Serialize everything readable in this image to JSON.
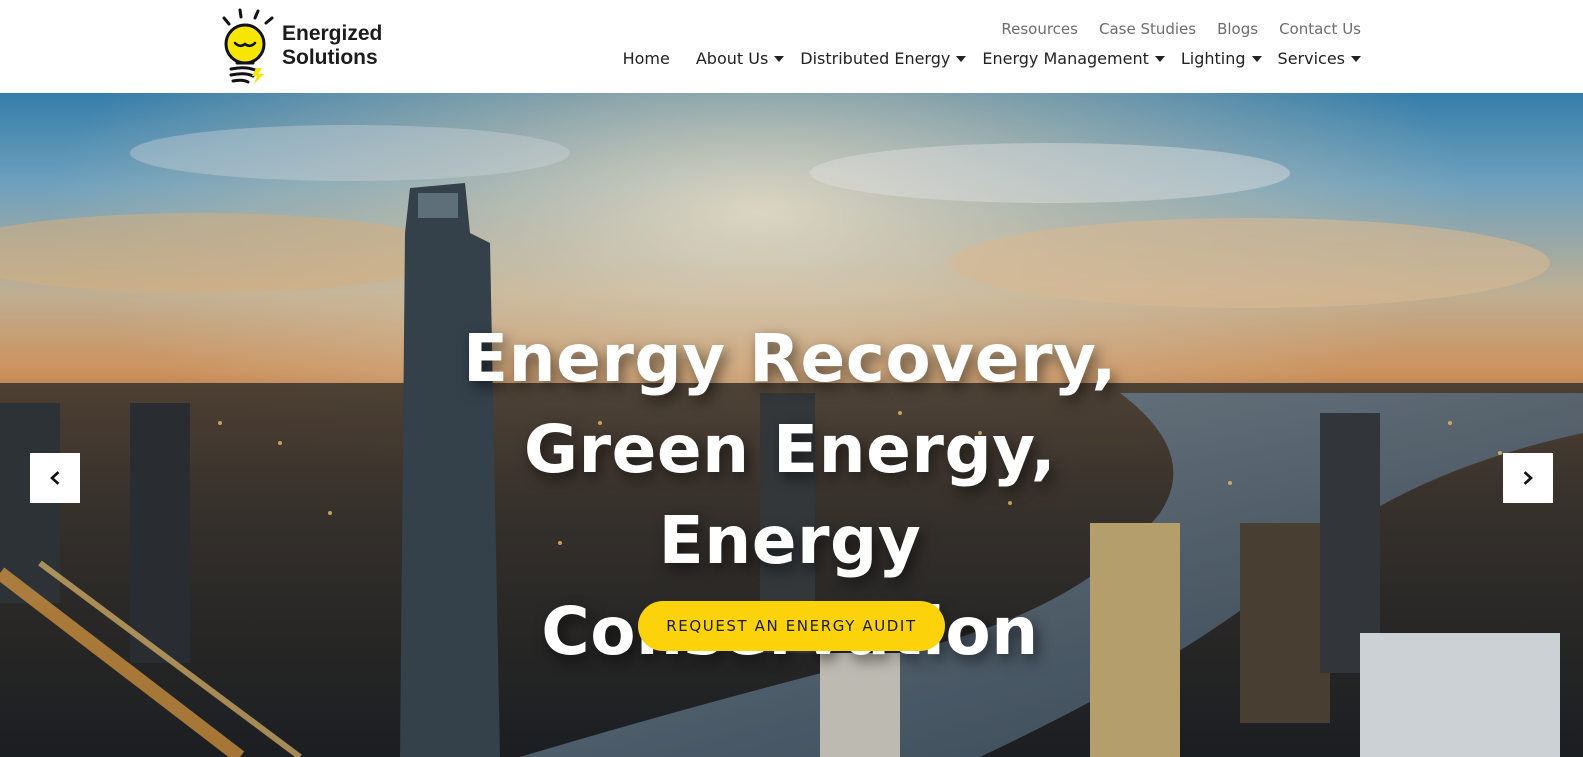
{
  "brand": {
    "line1": "Energized",
    "line2": "Solutions",
    "logo_icon": "lightbulb-icon",
    "accent_color": "#fcd30b"
  },
  "top_links": [
    "Resources",
    "Case Studies",
    "Blogs",
    "Contact Us"
  ],
  "nav": [
    {
      "label": "Home",
      "dropdown": false
    },
    {
      "label": "About Us",
      "dropdown": true
    },
    {
      "label": "Distributed Energy",
      "dropdown": true
    },
    {
      "label": "Energy Management",
      "dropdown": true
    },
    {
      "label": "Lighting",
      "dropdown": true
    },
    {
      "label": "Services",
      "dropdown": true
    }
  ],
  "hero": {
    "headline_lines": [
      "Energy Recovery,",
      "Green Energy, Energy",
      "Conservation"
    ],
    "cta_label": "REQUEST AN ENERGY AUDIT",
    "prev_icon": "chevron-left-icon",
    "next_icon": "chevron-right-icon",
    "background": "city skyline at sunset"
  }
}
